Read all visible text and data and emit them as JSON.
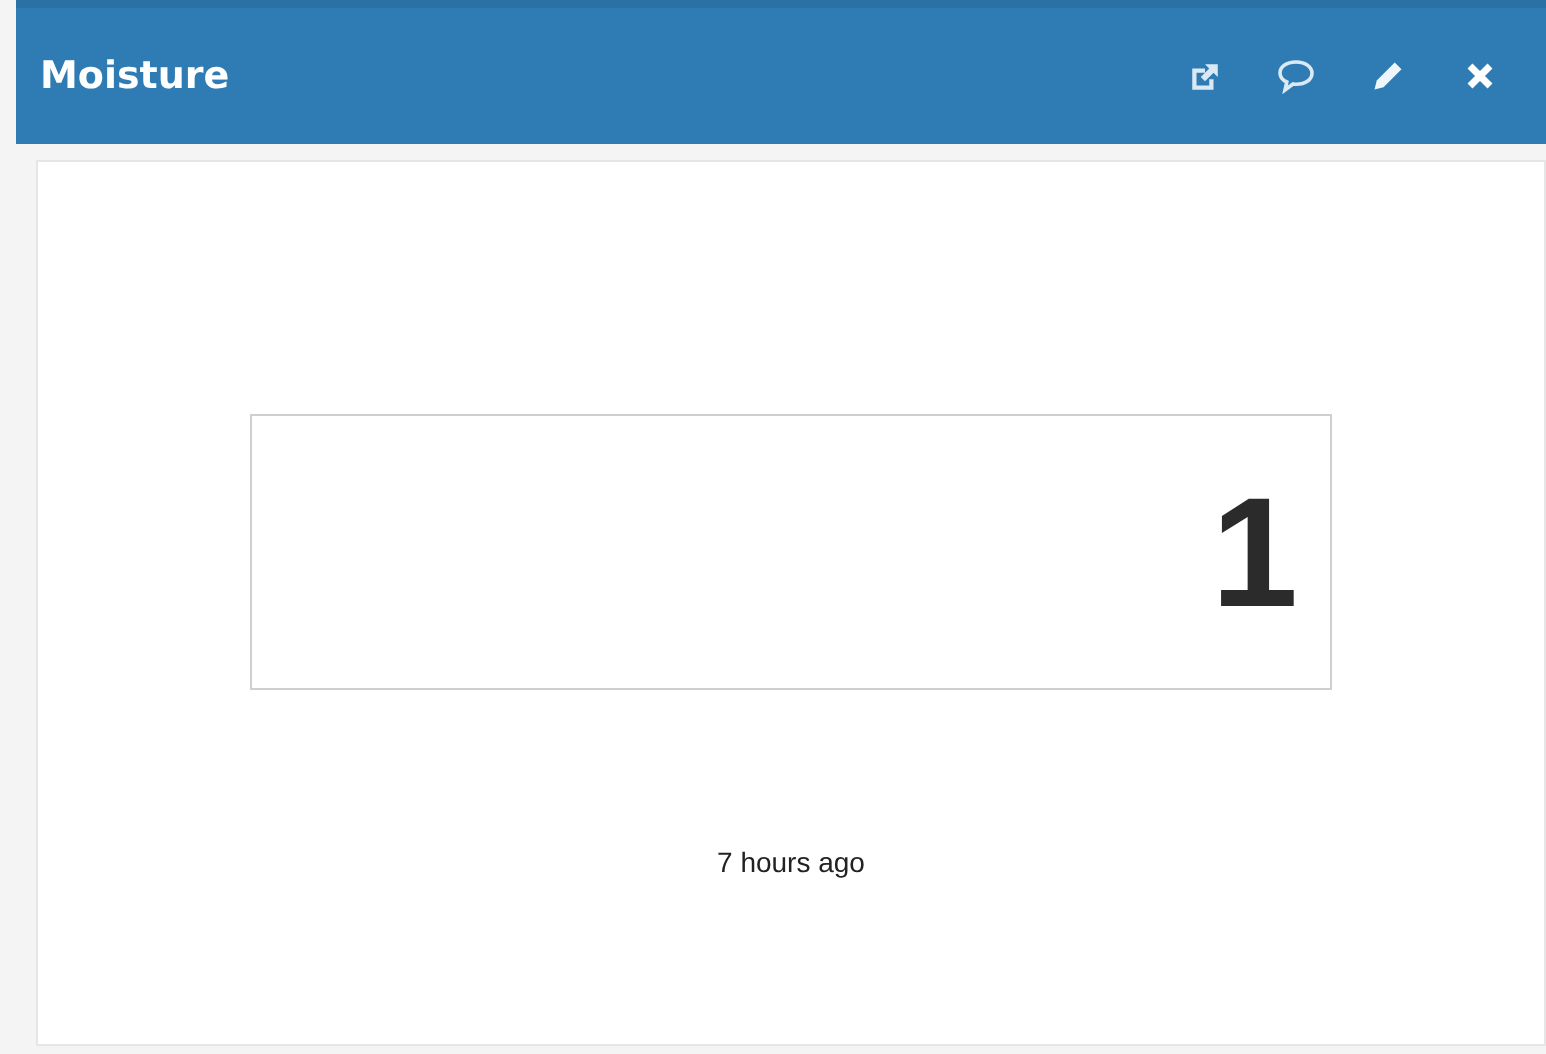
{
  "panel": {
    "title": "Moisture"
  },
  "reading": {
    "value": "1",
    "updated": "7 hours ago"
  }
}
